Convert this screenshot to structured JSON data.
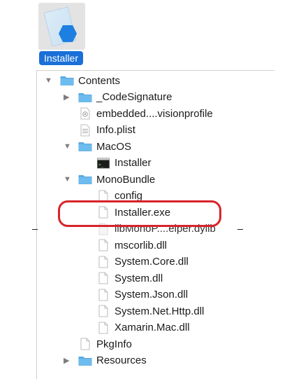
{
  "app": {
    "name": "Installer",
    "icon": "app-bundle-icon"
  },
  "tree": [
    {
      "id": "contents",
      "label": "Contents",
      "type": "folder",
      "expanded": true,
      "level": 0
    },
    {
      "id": "codesignature",
      "label": "_CodeSignature",
      "type": "folder",
      "expanded": false,
      "level": 1
    },
    {
      "id": "embedded",
      "label": "embedded....visionprofile",
      "type": "profile",
      "level": 1
    },
    {
      "id": "infoplist",
      "label": "Info.plist",
      "type": "plist",
      "level": 1
    },
    {
      "id": "macos",
      "label": "MacOS",
      "type": "folder",
      "expanded": true,
      "level": 1
    },
    {
      "id": "macos-installer",
      "label": "Installer",
      "type": "exec",
      "level": 2
    },
    {
      "id": "monobundle",
      "label": "MonoBundle",
      "type": "folder",
      "expanded": true,
      "level": 1
    },
    {
      "id": "config",
      "label": "config",
      "type": "file",
      "level": 2
    },
    {
      "id": "installer-exe",
      "label": "Installer.exe",
      "type": "file",
      "level": 2
    },
    {
      "id": "libmono",
      "label": "libMonoP....elper.dylib",
      "type": "dylib",
      "level": 2
    },
    {
      "id": "mscorlib",
      "label": "mscorlib.dll",
      "type": "file",
      "level": 2
    },
    {
      "id": "systemcore",
      "label": "System.Core.dll",
      "type": "file",
      "level": 2
    },
    {
      "id": "system",
      "label": "System.dll",
      "type": "file",
      "level": 2
    },
    {
      "id": "systemjson",
      "label": "System.Json.dll",
      "type": "file",
      "level": 2
    },
    {
      "id": "systemnethttp",
      "label": "System.Net.Http.dll",
      "type": "file",
      "level": 2
    },
    {
      "id": "xamarinmac",
      "label": "Xamarin.Mac.dll",
      "type": "file",
      "level": 2
    },
    {
      "id": "pkginfo",
      "label": "PkgInfo",
      "type": "file",
      "level": 1
    },
    {
      "id": "resources",
      "label": "Resources",
      "type": "folder",
      "expanded": false,
      "level": 1
    }
  ],
  "colors": {
    "selection": "#1a6fd8",
    "highlight_ring": "#d8232a",
    "folder": "#5ab0ea"
  }
}
